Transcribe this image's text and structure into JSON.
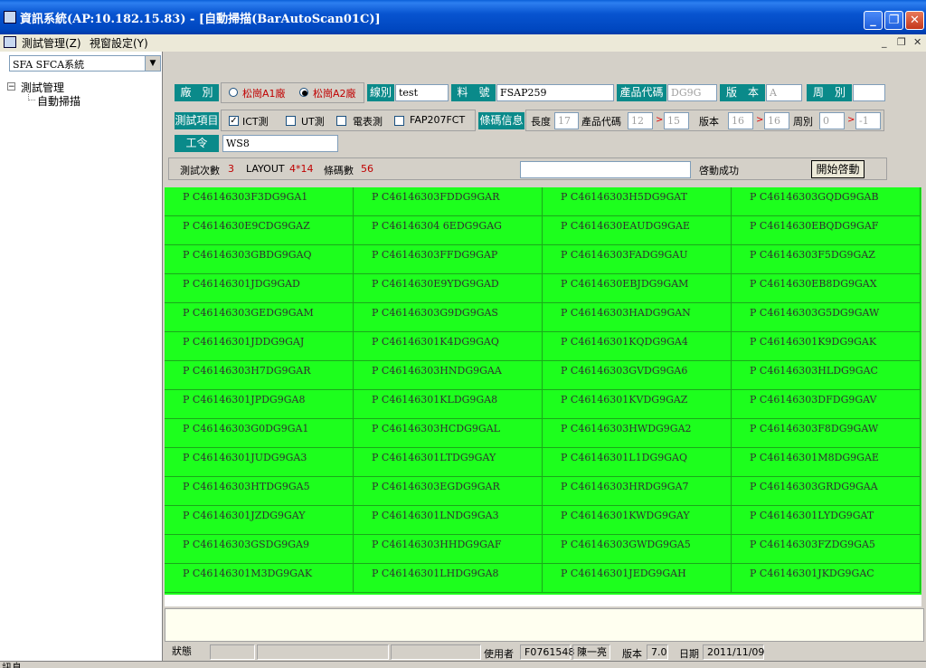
{
  "window": {
    "title": "資訊系統(AP:10.182.15.83) - [自動掃描(BarAutoScan01C)]",
    "min": "_",
    "max": "❐",
    "close": "✕"
  },
  "menu": {
    "items": [
      "測試管理(Z)",
      "視窗設定(Y)"
    ],
    "mdi": [
      "_",
      "❐",
      "✕"
    ]
  },
  "left": {
    "combo_value": "SFA SFCA系統",
    "tree_root": "測試管理",
    "tree_child": "自動掃描",
    "tree_toggle": "−"
  },
  "form": {
    "factory_label": "廠　別",
    "factory_options": [
      "松崗A1廠",
      "松崗A2廠"
    ],
    "factory_selected": 1,
    "line_label": "線別",
    "line_value": "test",
    "part_label": "料　號",
    "part_value": "FSAP259",
    "product_code_label": "產品代碼",
    "product_code_value": "DG9G",
    "version_label": "版　本",
    "version_value": "A",
    "week_label": "周　別",
    "week_value": "",
    "test_item_label": "測試項目",
    "test_items": [
      {
        "label": "ICT測",
        "checked": true
      },
      {
        "label": "UT測",
        "checked": false
      },
      {
        "label": "電表測",
        "checked": false
      },
      {
        "label": "FAP207FCT",
        "checked": false
      }
    ],
    "barcode_info_label": "條碼信息",
    "length_label": "長度",
    "length_value": "17",
    "pc_label": "產品代碼",
    "pc_from": "12",
    "pc_to": "15",
    "ver_label": "版本",
    "ver_from": "16",
    "ver_to": "16",
    "wk_label": "周別",
    "wk_from": "0",
    "wk_to": "-1",
    "arrow": ">",
    "order_label": "工令",
    "order_value": "WS8",
    "test_count_label": "測試次數",
    "test_count_value": "3",
    "layout_label": "LAYOUT",
    "layout_value": "4*14",
    "barcode_count_label": "條碼數",
    "barcode_count_value": "56",
    "scan_input": "",
    "start_status": "啓動成功",
    "start_button": "開始啓動"
  },
  "grid": {
    "rows": [
      [
        "P C46146303F3DG9GA1",
        "P C46146303FDDG9GAR",
        "P C46146303H5DG9GAT",
        "P C46146303GQDG9GAB"
      ],
      [
        "P C4614630E9CDG9GAZ",
        "P C46146304 6EDG9GAG",
        "P C4614630EAUDG9GAE",
        "P C4614630EBQDG9GAF"
      ],
      [
        "P C46146303GBDG9GAQ",
        "P C46146303FFDG9GAP",
        "P C46146303FADG9GAU",
        "P C46146303F5DG9GAZ"
      ],
      [
        "P C46146301JDG9GAD",
        "P C4614630E9YDG9GAD",
        "P C4614630EBJDG9GAM",
        "P C4614630EB8DG9GAX"
      ],
      [
        "P C46146303GEDG9GAM",
        "P C46146303G9DG9GAS",
        "P C46146303HADG9GAN",
        "P C46146303G5DG9GAW"
      ],
      [
        "P C46146301JDDG9GAJ",
        "P C46146301K4DG9GAQ",
        "P C46146301KQDG9GA4",
        "P C46146301K9DG9GAK"
      ],
      [
        "P C46146303H7DG9GAR",
        "P C46146303HNDG9GAA",
        "P C46146303GVDG9GA6",
        "P C46146303HLDG9GAC"
      ],
      [
        "P C46146301JPDG9GA8",
        "P C46146301KLDG9GA8",
        "P C46146301KVDG9GAZ",
        "P C46146303DFDG9GAV"
      ],
      [
        "P C46146303G0DG9GA1",
        "P C46146303HCDG9GAL",
        "P C46146303HWDG9GA2",
        "P C46146303F8DG9GAW"
      ],
      [
        "P C46146301JUDG9GA3",
        "P C46146301LTDG9GAY",
        "P C46146301L1DG9GAQ",
        "P C46146301M8DG9GAE"
      ],
      [
        "P C46146303HTDG9GA5",
        "P C46146303EGDG9GAR",
        "P C46146303HRDG9GA7",
        "P C46146303GRDG9GAA"
      ],
      [
        "P C46146301JZDG9GAY",
        "P C46146301LNDG9GA3",
        "P C46146301KWDG9GAY",
        "P C46146301LYDG9GAT"
      ],
      [
        "P C46146303GSDG9GA9",
        "P C46146303HHDG9GAF",
        "P C46146303GWDG9GA5",
        "P C46146303FZDG9GA5"
      ],
      [
        "P C46146301M3DG9GAK",
        "P C46146301LHDG9GA8",
        "P C46146301JEDG9GAH",
        "P C46146301JKDG9GAC"
      ]
    ]
  },
  "status": {
    "state_label": "狀態",
    "user_label": "使用者",
    "user_id": "F0761548",
    "user_name": "陳一亮",
    "version_label": "版本",
    "version_value": "7.0",
    "date_label": "日期",
    "date_value": "2011/11/09"
  },
  "bottom": {
    "label": "訊息"
  },
  "colors": {
    "grid_bg": "#1dff1d",
    "label_bg": "#0a8a8a",
    "titlebar": "#0854d0",
    "accent_red": "#c00000"
  }
}
